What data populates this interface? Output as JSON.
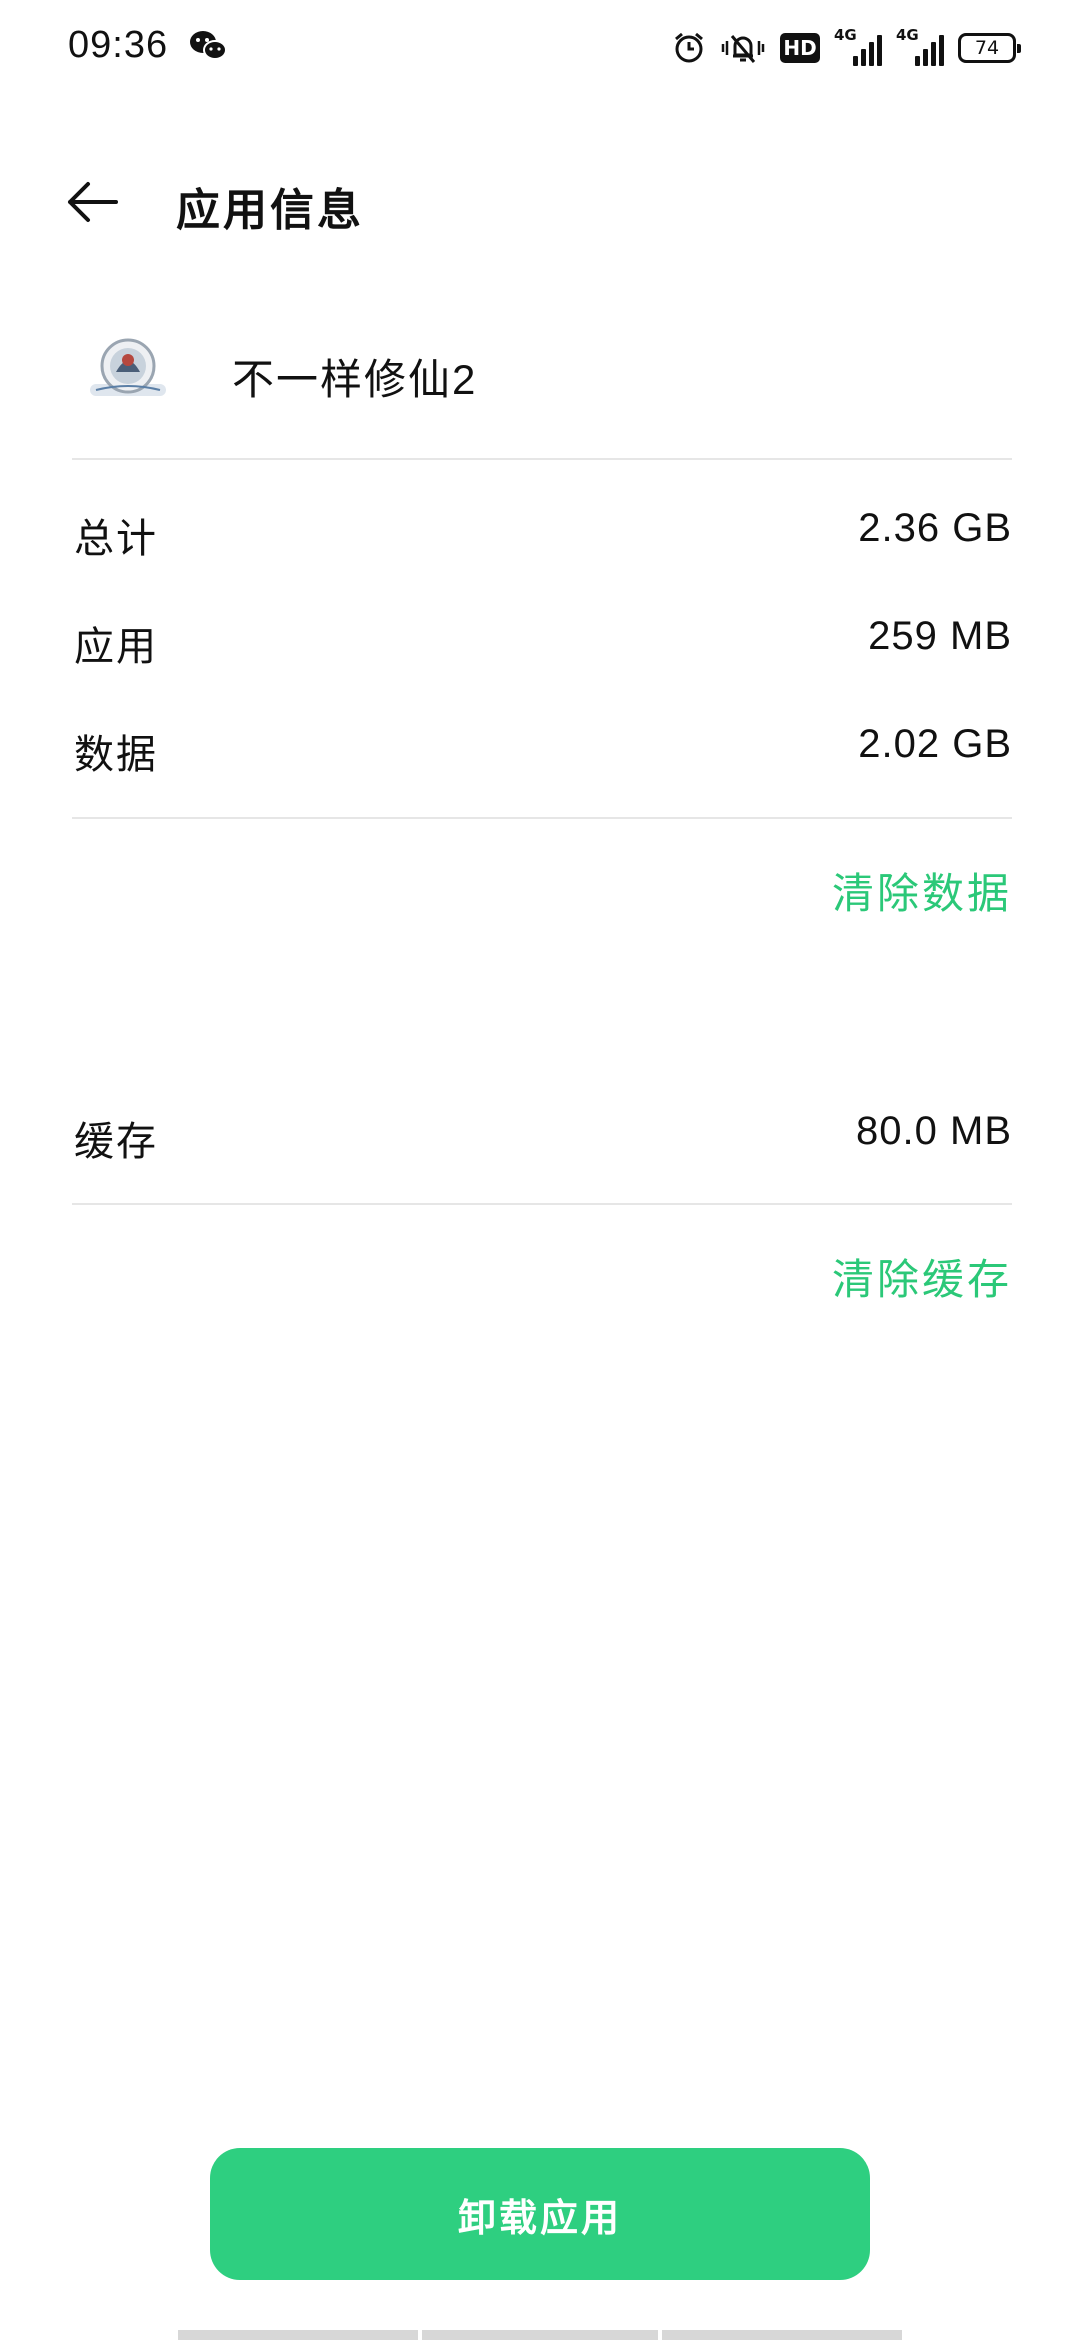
{
  "status_bar": {
    "time": "09:36",
    "network_1": "4G",
    "network_2": "4G",
    "hd_badge": "HD",
    "battery_level": "74",
    "icons": [
      "wechat-icon",
      "alarm-icon",
      "silent-bell-icon",
      "hd-icon",
      "signal-icon",
      "signal-icon",
      "battery-icon"
    ]
  },
  "header": {
    "title": "应用信息",
    "back_icon": "arrow-left-icon"
  },
  "app": {
    "name": "不一样修仙2"
  },
  "storage": {
    "rows": [
      {
        "label": "总计",
        "value": "2.36 GB"
      },
      {
        "label": "应用",
        "value": "259 MB"
      },
      {
        "label": "数据",
        "value": "2.02 GB"
      }
    ],
    "clear_data_label": "清除数据"
  },
  "cache": {
    "label": "缓存",
    "value": "80.0 MB",
    "clear_cache_label": "清除缓存"
  },
  "footer": {
    "uninstall_label": "卸载应用"
  },
  "colors": {
    "accent": "#2bc878",
    "button": "#2ecf80",
    "divider": "#e6e6e6",
    "text": "#111111"
  }
}
